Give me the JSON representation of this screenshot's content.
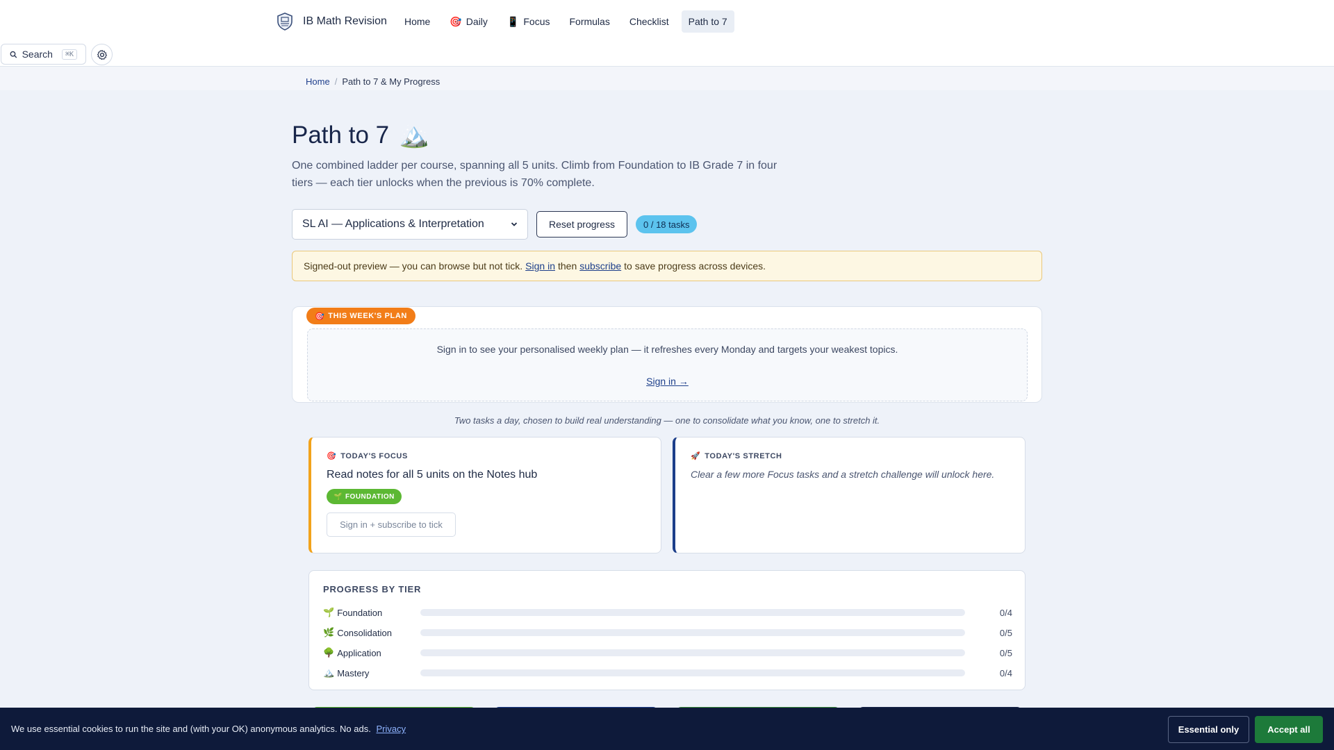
{
  "header": {
    "brand": "IB Math Revision",
    "nav": [
      {
        "icon": "🎯",
        "label": "Home",
        "has_icon": false
      },
      {
        "icon": "🎯",
        "label": "Daily",
        "has_icon": true
      },
      {
        "icon": "📱",
        "label": "Focus",
        "has_icon": true
      },
      {
        "icon": "",
        "label": "Formulas",
        "has_icon": false
      },
      {
        "icon": "",
        "label": "Checklist",
        "has_icon": false
      },
      {
        "icon": "",
        "label": "Path to 7",
        "has_icon": false,
        "active": true
      }
    ],
    "search_label": "Search",
    "search_shortcut": "⌘K"
  },
  "breadcrumb": {
    "home": "Home",
    "separator": "/",
    "current": "Path to 7 & My Progress"
  },
  "page": {
    "title": "Path to 7",
    "title_emoji": "🏔️",
    "subtitle": "One combined ladder per course, spanning all 5 units. Climb from Foundation to IB Grade 7 in four tiers — each tier unlocks when the previous is 70% complete."
  },
  "controls": {
    "course_selected": "SL AI — Applications & Interpretation",
    "reset_label": "Reset progress",
    "task_badge": "0 / 18 tasks"
  },
  "notice": {
    "prefix": "Signed-out preview — you can browse but not tick.",
    "sign_in": "Sign in",
    "middle": "then",
    "subscribe": "subscribe",
    "suffix": "to save progress across devices."
  },
  "weekly_plan": {
    "tag_icon": "🎯",
    "tag": "THIS WEEK'S PLAN",
    "message": "Sign in to see your personalised weekly plan — it refreshes every Monday and targets your weakest topics.",
    "link": "Sign in →"
  },
  "tagline": "Two tasks a day, chosen to build real understanding — one to consolidate what you know, one to stretch it.",
  "focus_card": {
    "icon": "🎯",
    "title": "TODAY'S FOCUS",
    "task": "Read notes for all 5 units on the Notes hub",
    "tier_icon": "🌱",
    "tier": "FOUNDATION",
    "button": "Sign in + subscribe to tick"
  },
  "stretch_card": {
    "icon": "🚀",
    "title": "TODAY'S STRETCH",
    "message": "Clear a few more Focus tasks and a stretch challenge will unlock here."
  },
  "progress": {
    "title": "PROGRESS BY TIER",
    "tiers": [
      {
        "icon": "🌱",
        "name": "Foundation",
        "count": "0/4",
        "fraction": 0
      },
      {
        "icon": "🌿",
        "name": "Consolidation",
        "count": "0/5",
        "fraction": 0
      },
      {
        "icon": "🌳",
        "name": "Application",
        "count": "0/5",
        "fraction": 0
      },
      {
        "icon": "🏔️",
        "name": "Mastery",
        "count": "0/4",
        "fraction": 0
      }
    ]
  },
  "colors": {
    "accent_orange": "#f27d18",
    "focus_border": "#f2a31b",
    "stretch_border": "#1c3e8a",
    "foundation_green": "#5cb833",
    "cookie_bg": "#0e1a3a",
    "accept_green": "#1d7a3a"
  },
  "cookie": {
    "text": "We use essential cookies to run the site and (with your OK) anonymous analytics. No ads.",
    "privacy": "Privacy",
    "essential": "Essential only",
    "accept": "Accept all"
  }
}
